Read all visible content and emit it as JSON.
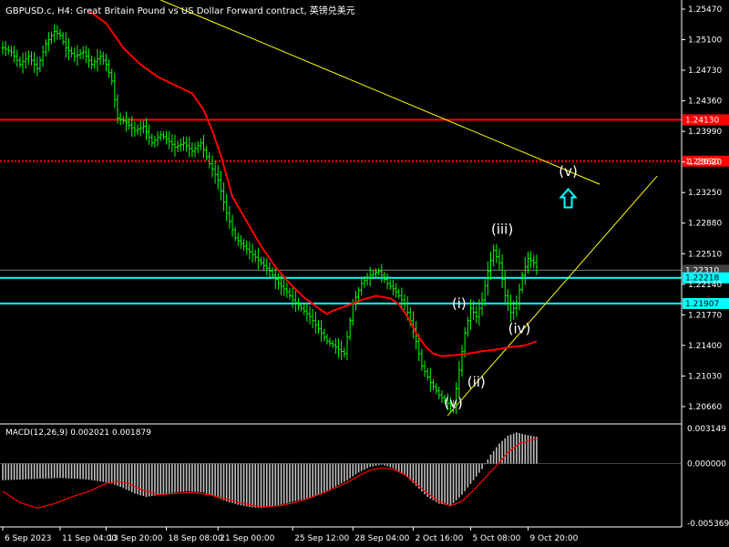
{
  "header": {
    "title": "GBPUSD.c, H4:  Great Britain Pound vs US Dollar Forward contract, 英镑兑美元"
  },
  "macd_panel": {
    "label": "MACD(12,26,9) 0.002021 0.001879",
    "ticks": [
      {
        "label": "0.003149",
        "value": 0.003149
      },
      {
        "label": "0.000000",
        "value": 0
      },
      {
        "label": "-0.005369",
        "value": -0.005369
      }
    ]
  },
  "colors": {
    "background": "#000000",
    "bull": "#00ff00",
    "ma": "#ff0000",
    "support": "#00ffff",
    "resistance": "#ff0000",
    "trendline": "#ffff00",
    "wave_label": "#ffffff",
    "arrow": "#00ffff",
    "macd_hist": "#c0c0c0"
  },
  "chart_data": {
    "type": "line",
    "symbol": "GBPUSD.c",
    "timeframe": "H4",
    "price_axis": {
      "ylim": [
        1.2045,
        1.2558
      ],
      "ticks": [
        "1.25470",
        "1.25100",
        "1.24730",
        "1.24360",
        "1.23990",
        "1.23620",
        "1.23250",
        "1.22880",
        "1.22510",
        "1.22140",
        "1.21770",
        "1.21400",
        "1.21030",
        "1.20660"
      ]
    },
    "time_axis": {
      "ticks": [
        "6 Sep 2023",
        "11 Sep 04:00",
        "13 Sep 20:00",
        "18 Sep 08:00",
        "21 Sep 00:00",
        "25 Sep 12:00",
        "28 Sep 04:00",
        "2 Oct 16:00",
        "5 Oct 08:00",
        "9 Oct 20:00"
      ],
      "tick_bars": [
        0,
        20,
        36,
        57,
        75,
        101,
        122,
        143,
        163,
        183
      ]
    },
    "price_series": [
      [
        0,
        1.25
      ],
      [
        3,
        1.2495
      ],
      [
        6,
        1.248
      ],
      [
        9,
        1.249
      ],
      [
        12,
        1.2475
      ],
      [
        15,
        1.2505
      ],
      [
        18,
        1.252
      ],
      [
        20,
        1.2515
      ],
      [
        22,
        1.25
      ],
      [
        25,
        1.249
      ],
      [
        28,
        1.2495
      ],
      [
        31,
        1.248
      ],
      [
        34,
        1.249
      ],
      [
        36,
        1.248
      ],
      [
        38,
        1.246
      ],
      [
        40,
        1.2415
      ],
      [
        43,
        1.241
      ],
      [
        46,
        1.24
      ],
      [
        49,
        1.2405
      ],
      [
        52,
        1.2385
      ],
      [
        55,
        1.2395
      ],
      [
        57,
        1.239
      ],
      [
        60,
        1.238
      ],
      [
        63,
        1.2385
      ],
      [
        66,
        1.2375
      ],
      [
        69,
        1.2385
      ],
      [
        72,
        1.236
      ],
      [
        75,
        1.234
      ],
      [
        78,
        1.23
      ],
      [
        81,
        1.227
      ],
      [
        84,
        1.226
      ],
      [
        87,
        1.225
      ],
      [
        90,
        1.224
      ],
      [
        93,
        1.223
      ],
      [
        96,
        1.2215
      ],
      [
        99,
        1.2205
      ],
      [
        101,
        1.2195
      ],
      [
        104,
        1.2185
      ],
      [
        107,
        1.2175
      ],
      [
        110,
        1.216
      ],
      [
        113,
        1.2145
      ],
      [
        116,
        1.2138
      ],
      [
        119,
        1.213
      ],
      [
        122,
        1.219
      ],
      [
        125,
        1.2215
      ],
      [
        128,
        1.2225
      ],
      [
        131,
        1.223
      ],
      [
        134,
        1.2215
      ],
      [
        137,
        1.2205
      ],
      [
        140,
        1.219
      ],
      [
        143,
        1.216
      ],
      [
        146,
        1.2115
      ],
      [
        149,
        1.2095
      ],
      [
        152,
        1.208
      ],
      [
        155,
        1.207
      ],
      [
        157,
        1.2065
      ],
      [
        159,
        1.211
      ],
      [
        161,
        1.2155
      ],
      [
        163,
        1.2185
      ],
      [
        165,
        1.2175
      ],
      [
        167,
        1.2195
      ],
      [
        169,
        1.223
      ],
      [
        171,
        1.2255
      ],
      [
        173,
        1.224
      ],
      [
        175,
        1.22
      ],
      [
        177,
        1.218
      ],
      [
        179,
        1.219
      ],
      [
        181,
        1.2225
      ],
      [
        183,
        1.2245
      ],
      [
        185,
        1.224
      ],
      [
        186,
        1.2235
      ]
    ],
    "ma_series": [
      [
        30,
        1.2545
      ],
      [
        36,
        1.253
      ],
      [
        42,
        1.25
      ],
      [
        48,
        1.248
      ],
      [
        54,
        1.2465
      ],
      [
        60,
        1.2455
      ],
      [
        66,
        1.2445
      ],
      [
        70,
        1.2425
      ],
      [
        73,
        1.24
      ],
      [
        76,
        1.237
      ],
      [
        80,
        1.232
      ],
      [
        85,
        1.229
      ],
      [
        90,
        1.226
      ],
      [
        95,
        1.2235
      ],
      [
        100,
        1.2215
      ],
      [
        105,
        1.2198
      ],
      [
        110,
        1.2185
      ],
      [
        113,
        1.2178
      ],
      [
        115,
        1.2182
      ],
      [
        120,
        1.2188
      ],
      [
        125,
        1.2195
      ],
      [
        130,
        1.22
      ],
      [
        135,
        1.2197
      ],
      [
        138,
        1.219
      ],
      [
        141,
        1.2175
      ],
      [
        144,
        1.2155
      ],
      [
        147,
        1.214
      ],
      [
        150,
        1.213
      ],
      [
        153,
        1.2127
      ],
      [
        157,
        1.2128
      ],
      [
        162,
        1.213
      ],
      [
        167,
        1.2133
      ],
      [
        172,
        1.2135
      ],
      [
        177,
        1.2138
      ],
      [
        182,
        1.214
      ],
      [
        186,
        1.2145
      ]
    ],
    "horizontal_levels": [
      {
        "price": 1.2413,
        "label": "1.24130",
        "style": "solid",
        "color": "#ff0000"
      },
      {
        "price": 1.2363,
        "label": "1.23630",
        "style": "dotted",
        "color": "#ff0000"
      },
      {
        "price": 1.2231,
        "label": "1.22310",
        "style": "solid",
        "color": "#808080"
      },
      {
        "price": 1.22218,
        "label": "1.22218",
        "style": "solid",
        "color": "#00ffff"
      },
      {
        "price": 1.21907,
        "label": "1.21907",
        "style": "solid",
        "color": "#00ffff"
      }
    ],
    "trendlines": [
      {
        "from": [
          55,
          1.2558
        ],
        "to": [
          208,
          1.2335
        ]
      },
      {
        "from": [
          155,
          1.2055
        ],
        "to": [
          228,
          1.2345
        ]
      }
    ],
    "wave_labels": [
      {
        "text": "(v)",
        "bar": 157,
        "price": 1.2065
      },
      {
        "text": "(i)",
        "bar": 159,
        "price": 1.2185
      },
      {
        "text": "(ii)",
        "bar": 165,
        "price": 1.209
      },
      {
        "text": "(iii)",
        "bar": 174,
        "price": 1.2275
      },
      {
        "text": "(iv)",
        "bar": 180,
        "price": 1.2155
      },
      {
        "text": "(v)",
        "bar": 197,
        "price": 1.2345
      }
    ],
    "arrow": {
      "bar": 197,
      "price": 1.2318,
      "direction": "up"
    },
    "macd": {
      "ylim": [
        -0.005369,
        0.003149
      ],
      "histogram": [
        [
          0,
          -0.0015
        ],
        [
          10,
          -0.0014
        ],
        [
          20,
          -0.0013
        ],
        [
          28,
          -0.0014
        ],
        [
          34,
          -0.0016
        ],
        [
          38,
          -0.0018
        ],
        [
          42,
          -0.0022
        ],
        [
          46,
          -0.0027
        ],
        [
          50,
          -0.003
        ],
        [
          55,
          -0.0028
        ],
        [
          60,
          -0.0026
        ],
        [
          65,
          -0.0025
        ],
        [
          70,
          -0.0026
        ],
        [
          74,
          -0.003
        ],
        [
          78,
          -0.0034
        ],
        [
          82,
          -0.0037
        ],
        [
          86,
          -0.0039
        ],
        [
          90,
          -0.004
        ],
        [
          95,
          -0.0038
        ],
        [
          100,
          -0.0035
        ],
        [
          105,
          -0.0032
        ],
        [
          110,
          -0.0028
        ],
        [
          115,
          -0.0022
        ],
        [
          120,
          -0.0015
        ],
        [
          124,
          -0.0008
        ],
        [
          128,
          -0.0003
        ],
        [
          132,
          -0.0001
        ],
        [
          136,
          -0.0004
        ],
        [
          140,
          -0.001
        ],
        [
          144,
          -0.002
        ],
        [
          148,
          -0.003
        ],
        [
          152,
          -0.0036
        ],
        [
          156,
          -0.0038
        ],
        [
          160,
          -0.0028
        ],
        [
          164,
          -0.0015
        ],
        [
          167,
          -0.0005
        ],
        [
          170,
          0.0008
        ],
        [
          173,
          0.0018
        ],
        [
          176,
          0.0025
        ],
        [
          179,
          0.0028
        ],
        [
          182,
          0.0026
        ],
        [
          186,
          0.0024
        ]
      ],
      "signal": [
        [
          0,
          -0.0025
        ],
        [
          6,
          -0.0035
        ],
        [
          12,
          -0.004
        ],
        [
          18,
          -0.0036
        ],
        [
          24,
          -0.003
        ],
        [
          30,
          -0.0025
        ],
        [
          36,
          -0.0018
        ],
        [
          40,
          -0.0016
        ],
        [
          44,
          -0.0018
        ],
        [
          48,
          -0.0023
        ],
        [
          54,
          -0.0028
        ],
        [
          60,
          -0.0027
        ],
        [
          66,
          -0.0026
        ],
        [
          72,
          -0.0028
        ],
        [
          78,
          -0.0032
        ],
        [
          84,
          -0.0036
        ],
        [
          90,
          -0.0039
        ],
        [
          96,
          -0.0038
        ],
        [
          102,
          -0.0035
        ],
        [
          108,
          -0.003
        ],
        [
          114,
          -0.0024
        ],
        [
          120,
          -0.0017
        ],
        [
          124,
          -0.0011
        ],
        [
          128,
          -0.0006
        ],
        [
          132,
          -0.0004
        ],
        [
          136,
          -0.0005
        ],
        [
          140,
          -0.001
        ],
        [
          144,
          -0.0018
        ],
        [
          148,
          -0.0027
        ],
        [
          152,
          -0.0034
        ],
        [
          156,
          -0.0038
        ],
        [
          160,
          -0.0034
        ],
        [
          164,
          -0.0024
        ],
        [
          168,
          -0.0013
        ],
        [
          172,
          -0.0002
        ],
        [
          176,
          0.001
        ],
        [
          180,
          0.0018
        ],
        [
          184,
          0.0021
        ],
        [
          186,
          0.0022
        ]
      ]
    }
  }
}
